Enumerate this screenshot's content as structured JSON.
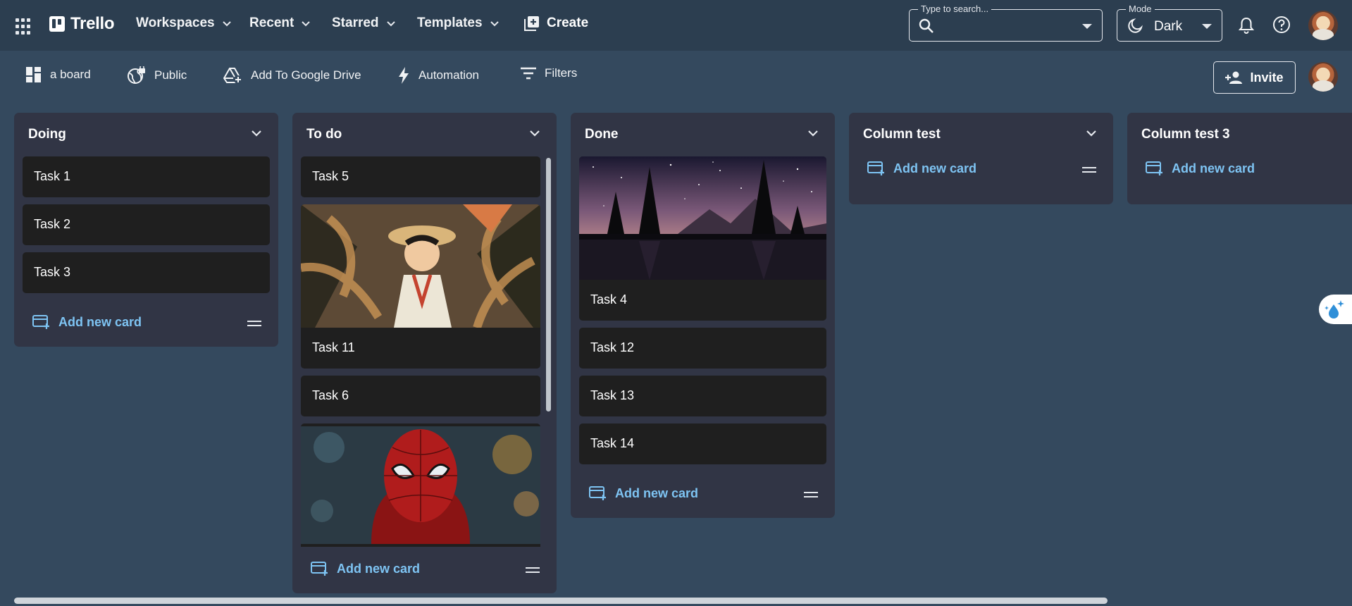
{
  "appbar": {
    "brand": "Trello",
    "menu": [
      {
        "label": "Workspaces"
      },
      {
        "label": "Recent"
      },
      {
        "label": "Starred"
      },
      {
        "label": "Templates"
      }
    ],
    "create_label": "Create",
    "search": {
      "legend": "Type to search...",
      "value": ""
    },
    "mode": {
      "legend": "Mode",
      "value": "Dark"
    }
  },
  "boardbar": {
    "board_name": "a board",
    "visibility": "Public",
    "google_drive": "Add To Google Drive",
    "automation": "Automation",
    "filters": "Filters",
    "invite": "Invite"
  },
  "columns": [
    {
      "title": "Doing",
      "cards": [
        {
          "title": "Task 1"
        },
        {
          "title": "Task 2"
        },
        {
          "title": "Task 3"
        }
      ],
      "add_label": "Add new card"
    },
    {
      "title": "To do",
      "cards": [
        {
          "title": "Task 5"
        },
        {
          "title": "Task 11",
          "cover": "anime-jungle"
        },
        {
          "title": "Task 6"
        },
        {
          "title": "",
          "cover": "spiderman"
        }
      ],
      "add_label": "Add new card"
    },
    {
      "title": "Done",
      "cards": [
        {
          "title": "Task 4",
          "cover": "night-lake"
        },
        {
          "title": "Task 12"
        },
        {
          "title": "Task 13"
        },
        {
          "title": "Task 14"
        }
      ],
      "add_label": "Add new card"
    },
    {
      "title": "Column test",
      "cards": [],
      "add_label": "Add new card"
    },
    {
      "title": "Column test 3",
      "cards": [],
      "add_label": "Add new card"
    }
  ],
  "colors": {
    "background": "#34495e",
    "appbar": "#2c3e50",
    "column": "#313545",
    "card": "#1f1f1f",
    "accent": "#7ec4f3"
  }
}
